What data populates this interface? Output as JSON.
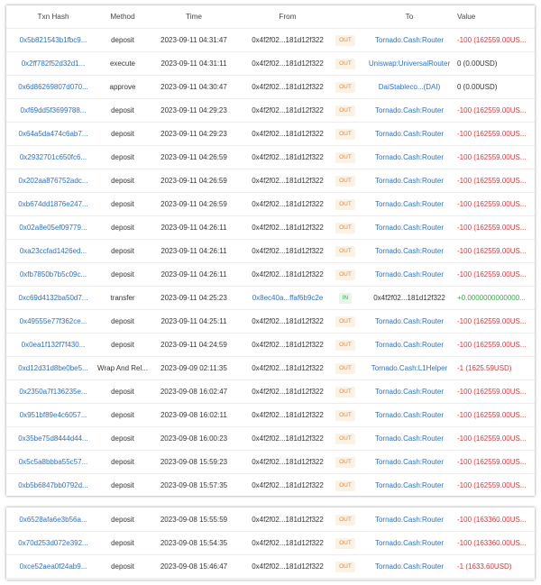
{
  "header": {
    "txn_hash": "Txn Hash",
    "method": "Method",
    "time": "Time",
    "from": "From",
    "to": "To",
    "value": "Value"
  },
  "colors": {
    "link": "#2f6fc0",
    "negative": "#d9363e",
    "positive": "#3aa94a",
    "out_badge": "#e8893a",
    "in_badge": "#3aa94a"
  },
  "rows": [
    {
      "hash": "0x5b821543b1fbc9...",
      "method": "deposit",
      "time": "2023-09-11 04:31:47",
      "from": "0x4f2f02...181d12f322",
      "dir": "OUT",
      "to": "Tornado.Cash:Router",
      "value": "-100 (162559.00US..."
    },
    {
      "hash": "0x2ff782f52d32d1...",
      "method": "execute",
      "time": "2023-09-11 04:31:11",
      "from": "0x4f2f02...181d12f322",
      "dir": "OUT",
      "to": "Uniswap:UniversalRouter",
      "value": "0 (0.00USD)"
    },
    {
      "hash": "0x6d86269807d070...",
      "method": "approve",
      "time": "2023-09-11 04:30:47",
      "from": "0x4f2f02...181d12f322",
      "dir": "OUT",
      "to": "DaiStableco...(DAI)",
      "value": "0 (0.00USD)"
    },
    {
      "hash": "0xf69dd5f3699788...",
      "method": "deposit",
      "time": "2023-09-11 04:29:23",
      "from": "0x4f2f02...181d12f322",
      "dir": "OUT",
      "to": "Tornado.Cash:Router",
      "value": "-100 (162559.00US..."
    },
    {
      "hash": "0x64a5da474c6ab7...",
      "method": "deposit",
      "time": "2023-09-11 04:29:23",
      "from": "0x4f2f02...181d12f322",
      "dir": "OUT",
      "to": "Tornado.Cash:Router",
      "value": "-100 (162559.00US..."
    },
    {
      "hash": "0x2932701c650fc6...",
      "method": "deposit",
      "time": "2023-09-11 04:26:59",
      "from": "0x4f2f02...181d12f322",
      "dir": "OUT",
      "to": "Tornado.Cash:Router",
      "value": "-100 (162559.00US..."
    },
    {
      "hash": "0x202aa876752adc...",
      "method": "deposit",
      "time": "2023-09-11 04:26:59",
      "from": "0x4f2f02...181d12f322",
      "dir": "OUT",
      "to": "Tornado.Cash:Router",
      "value": "-100 (162559.00US..."
    },
    {
      "hash": "0xb674dd1876e247...",
      "method": "deposit",
      "time": "2023-09-11 04:26:59",
      "from": "0x4f2f02...181d12f322",
      "dir": "OUT",
      "to": "Tornado.Cash:Router",
      "value": "-100 (162559.00US..."
    },
    {
      "hash": "0x02a8e05ef09779...",
      "method": "deposit",
      "time": "2023-09-11 04:26:11",
      "from": "0x4f2f02...181d12f322",
      "dir": "OUT",
      "to": "Tornado.Cash:Router",
      "value": "-100 (162559.00US..."
    },
    {
      "hash": "0xa23ccfad1426ed...",
      "method": "deposit",
      "time": "2023-09-11 04:26:11",
      "from": "0x4f2f02...181d12f322",
      "dir": "OUT",
      "to": "Tornado.Cash:Router",
      "value": "-100 (162559.00US..."
    },
    {
      "hash": "0xfb7850b7b5c09c...",
      "method": "deposit",
      "time": "2023-09-11 04:26:11",
      "from": "0x4f2f02...181d12f322",
      "dir": "OUT",
      "to": "Tornado.Cash:Router",
      "value": "-100 (162559.00US..."
    },
    {
      "hash": "0xc69d4132ba50d7...",
      "method": "transfer",
      "time": "2023-09-11 04:25:23",
      "from": "0x8ec40a...ffaf6b9c2e",
      "dir": "IN",
      "to": "0x4f2f02...181d12f322",
      "value": "+0.0000000000000..."
    },
    {
      "hash": "0x49555e77f362ce...",
      "method": "deposit",
      "time": "2023-09-11 04:25:11",
      "from": "0x4f2f02...181d12f322",
      "dir": "OUT",
      "to": "Tornado.Cash:Router",
      "value": "-100 (162559.00US..."
    },
    {
      "hash": "0x0ea1f132f7f430...",
      "method": "deposit",
      "time": "2023-09-11 04:24:59",
      "from": "0x4f2f02...181d12f322",
      "dir": "OUT",
      "to": "Tornado.Cash:Router",
      "value": "-100 (162559.00US..."
    },
    {
      "hash": "0xd12d31d8be0be5...",
      "method": "Wrap And Rel...",
      "time": "2023-09-09 02:11:35",
      "from": "0x4f2f02...181d12f322",
      "dir": "OUT",
      "to": "Tornado.Cash:L1Helper",
      "value": "-1 (1625.59USD)"
    },
    {
      "hash": "0x2350a7f136235e...",
      "method": "deposit",
      "time": "2023-09-08 16:02:47",
      "from": "0x4f2f02...181d12f322",
      "dir": "OUT",
      "to": "Tornado.Cash:Router",
      "value": "-100 (162559.00US..."
    },
    {
      "hash": "0x951bf89e4c6057...",
      "method": "deposit",
      "time": "2023-09-08 16:02:11",
      "from": "0x4f2f02...181d12f322",
      "dir": "OUT",
      "to": "Tornado.Cash:Router",
      "value": "-100 (162559.00US..."
    },
    {
      "hash": "0x35be75d8444d44...",
      "method": "deposit",
      "time": "2023-09-08 16:00:23",
      "from": "0x4f2f02...181d12f322",
      "dir": "OUT",
      "to": "Tornado.Cash:Router",
      "value": "-100 (162559.00US..."
    },
    {
      "hash": "0x5c5a8bbba55c57...",
      "method": "deposit",
      "time": "2023-09-08 15:59:23",
      "from": "0x4f2f02...181d12f322",
      "dir": "OUT",
      "to": "Tornado.Cash:Router",
      "value": "-100 (162559.00US..."
    },
    {
      "hash": "0xb5b6847bb0792d...",
      "method": "deposit",
      "time": "2023-09-08 15:57:35",
      "from": "0x4f2f02...181d12f322",
      "dir": "OUT",
      "to": "Tornado.Cash:Router",
      "value": "-100 (162559.00US..."
    }
  ],
  "rows2": [
    {
      "hash": "0x6528afa6e3b56a...",
      "method": "deposit",
      "time": "2023-09-08 15:55:59",
      "from": "0x4f2f02...181d12f322",
      "dir": "OUT",
      "to": "Tornado.Cash:Router",
      "value": "-100 (163360.00US..."
    },
    {
      "hash": "0x70d253d072e392...",
      "method": "deposit",
      "time": "2023-09-08 15:54:35",
      "from": "0x4f2f02...181d12f322",
      "dir": "OUT",
      "to": "Tornado.Cash:Router",
      "value": "-100 (163360.00US..."
    },
    {
      "hash": "0xce52aea0f24ab9...",
      "method": "deposit",
      "time": "2023-09-08 15:46:47",
      "from": "0x4f2f02...181d12f322",
      "dir": "OUT",
      "to": "Tornado.Cash:Router",
      "value": "-1 (1633.60USD)"
    }
  ]
}
